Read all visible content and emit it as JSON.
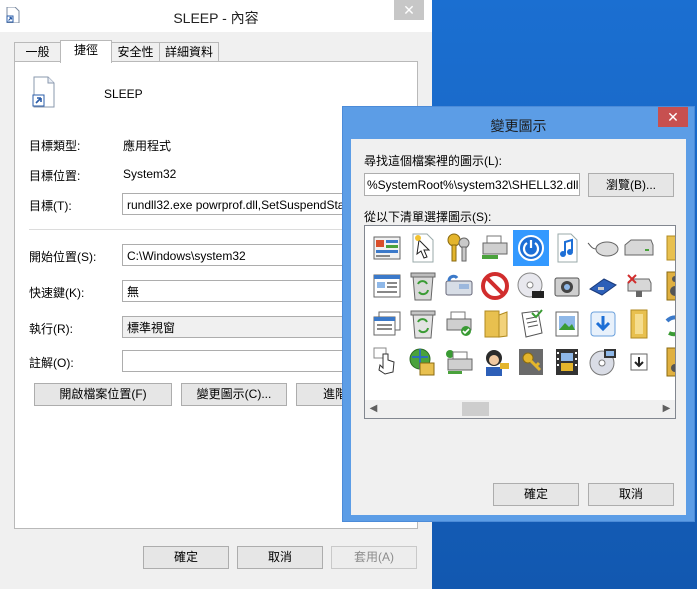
{
  "main_window": {
    "title": "SLEEP - 內容",
    "close_glyph": "✕",
    "tabs": [
      {
        "label": "一般"
      },
      {
        "label": "捷徑"
      },
      {
        "label": "安全性"
      },
      {
        "label": "詳細資料"
      }
    ],
    "shortcut_name": "SLEEP",
    "fields": {
      "target_type_label": "目標類型:",
      "target_type_value": "應用程式",
      "target_location_label": "目標位置:",
      "target_location_value": "System32",
      "target_label": "目標(T):",
      "target_value": "rundll32.exe powrprof.dll,SetSuspendState",
      "start_in_label": "開始位置(S):",
      "start_in_value": "C:\\Windows\\system32",
      "hotkey_label": "快速鍵(K):",
      "hotkey_value": "無",
      "run_label": "執行(R):",
      "run_value": "標準視窗",
      "comment_label": "註解(O):",
      "comment_value": ""
    },
    "buttons": {
      "open_location": "開啟檔案位置(F)",
      "change_icon": "變更圖示(C)...",
      "advanced": "進階",
      "ok": "確定",
      "cancel": "取消",
      "apply": "套用(A)"
    }
  },
  "change_icon_dialog": {
    "title": "變更圖示",
    "close_glyph": "✕",
    "search_label": "尋找這個檔案裡的圖示(L):",
    "path_value": "%SystemRoot%\\system32\\SHELL32.dll",
    "browse_button": "瀏覽(B)...",
    "list_label": "從以下清單選擇圖示(S):",
    "ok_button": "確定",
    "cancel_button": "取消",
    "scroll_left": "◀",
    "scroll_right": "▶",
    "icons": [
      "control-panel-icon",
      "shortcut-cursor-icon",
      "keys-icon",
      "printer-network-icon",
      "power-icon",
      "music-file-icon",
      "mouse-icon",
      "drive-icon",
      "folder-icon",
      "window-list-icon",
      "recycle-bin-full-icon",
      "fax-icon",
      "no-entry-icon",
      "dvd-icon",
      "camera-icon",
      "floppy-icon",
      "network-drive-error-icon",
      "audio-player-icon",
      "window-icon",
      "recycle-bin-icon",
      "printer-check-icon",
      "folder-open-icon",
      "document-check-icon",
      "image-icon",
      "download-icon",
      "folder-tall-icon",
      "ie-icon",
      "click-cursor-icon",
      "globe-person-icon",
      "printer-user-icon",
      "user-key-icon",
      "key-icon",
      "film-icon",
      "cd-sync-icon",
      "document-down-icon",
      "folder-music-icon",
      "red-arrow-icon"
    ]
  }
}
